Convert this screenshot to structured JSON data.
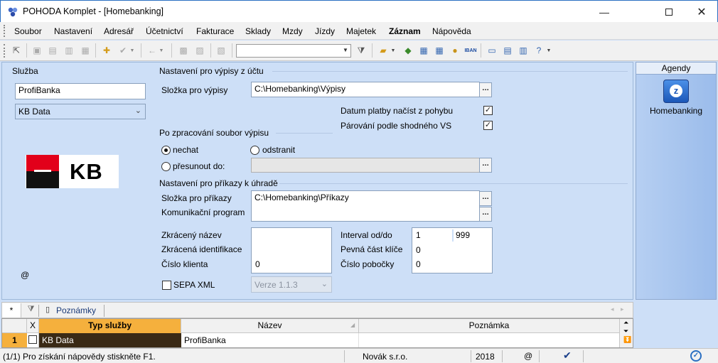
{
  "window": {
    "title": "POHODA Komplet - [Homebanking]"
  },
  "menu": [
    "Soubor",
    "Nastavení",
    "Adresář",
    "Účetnictví",
    "Fakturace",
    "Sklady",
    "Mzdy",
    "Jízdy",
    "Majetek",
    "Záznam",
    "Nápověda"
  ],
  "service": {
    "header": "Služba",
    "name_value": "ProfiBanka",
    "type_selected": "KB Data",
    "logo_text": "KB",
    "at_symbol": "@"
  },
  "statements": {
    "header": "Nastavení pro výpisy z účtu",
    "folder_label": "Složka pro výpisy",
    "folder_value": "C:\\Homebanking\\Výpisy",
    "date_check_label": "Datum platby načíst z pohybu",
    "pair_check_label": "Párování podle shodného VS",
    "after_header": "Po zpracování soubor výpisu",
    "opt_keep": "nechat",
    "opt_delete": "odstranit",
    "opt_move": "přesunout do:",
    "move_value": ""
  },
  "orders": {
    "header": "Nastavení pro příkazy k úhradě",
    "folder_label": "Složka pro příkazy",
    "folder_value": "C:\\Homebanking\\Příkazy",
    "comm_label": "Komunikační program",
    "comm_value": ""
  },
  "ids": {
    "short_name_label": "Zkrácený název",
    "short_id_label": "Zkrácená identifikace",
    "client_no_label": "Číslo klienta",
    "client_no_value": "0",
    "interval_label": "Interval od/do",
    "interval_from": "1",
    "interval_to": "999",
    "key_part_label": "Pevná část klíče",
    "key_part_value": "0",
    "branch_label": "Číslo pobočky",
    "branch_value": "0",
    "sepa_label": "SEPA XML",
    "sepa_version": "Verze 1.1.3"
  },
  "agenda": {
    "header": "Agendy",
    "item": "Homebanking"
  },
  "bottom_tabs": {
    "star": "*",
    "notes": "Poznámky"
  },
  "table": {
    "headers": [
      "X",
      "Typ služby",
      "Název",
      "Poznámka"
    ],
    "rows": [
      {
        "num": "1",
        "type": "KB Data",
        "name": "ProfiBanka",
        "note": ""
      }
    ]
  },
  "status": {
    "help": "(1/1) Pro získání nápovědy stiskněte F1.",
    "company": "Novák s.r.o.",
    "year": "2018",
    "at": "@"
  },
  "colors": {
    "accent": "#f5b03d",
    "kb_red": "#e2001a",
    "background": "#cddff7"
  }
}
